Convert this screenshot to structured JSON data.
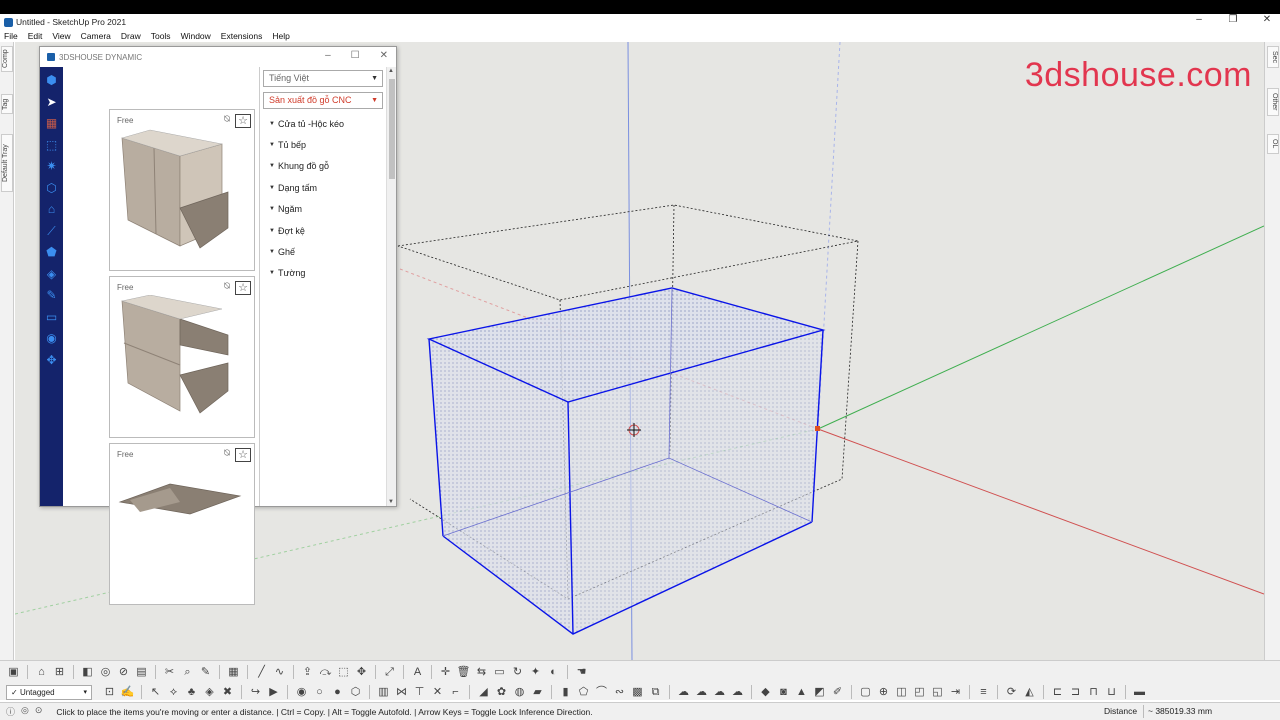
{
  "window": {
    "title": "Untitled - SketchUp Pro 2021",
    "minimize": "–",
    "maximize": "❐",
    "close": "✕"
  },
  "menu": [
    "File",
    "Edit",
    "View",
    "Camera",
    "Draw",
    "Tools",
    "Window",
    "Extensions",
    "Help"
  ],
  "left_tray_tabs": [
    "Comp",
    "Tag",
    "Default Tray"
  ],
  "right_tray_tabs": [
    "Sec",
    "Other",
    "OL"
  ],
  "watermark": "3dshouse.com",
  "plugin": {
    "title": "3DSHOUSE DYNAMIC",
    "sidebar_icons": [
      "help-icon",
      "cursor-icon",
      "cabinet-icon",
      "select-box-icon",
      "gear-icon",
      "cube-icon",
      "house-icon",
      "line-chart-icon",
      "puzzle-icon",
      "layers-icon",
      "pen-icon",
      "monitor-icon",
      "user-icon",
      "move-icon"
    ],
    "language_select": "Tiếng Việt",
    "category_select": "Sản xuất đồ gỗ CNC",
    "category_select_color": "#d03b2a",
    "categories": [
      "Cửa tủ -Hộc kéo",
      "Tủ bếp",
      "Khung đồ gỗ",
      "Dạng tấm",
      "Ngăm",
      "Đợt kệ",
      "Ghế",
      "Tường"
    ],
    "cards": [
      {
        "badge": "Free"
      },
      {
        "badge": "Free"
      },
      {
        "badge": "Free"
      }
    ]
  },
  "toolbar": {
    "tag_select": "Untagged"
  },
  "status": {
    "message": "Click to place the items you're moving or enter a distance. | Ctrl = Copy. | Alt = Toggle Autofold. | Arrow Keys = Toggle Lock Inference Direction.",
    "distance_label": "Distance",
    "distance_value": "~ 385019.33 mm"
  },
  "colors": {
    "accent": "#14236b",
    "selection": "#0000ff",
    "watermark": "#e2364f"
  }
}
